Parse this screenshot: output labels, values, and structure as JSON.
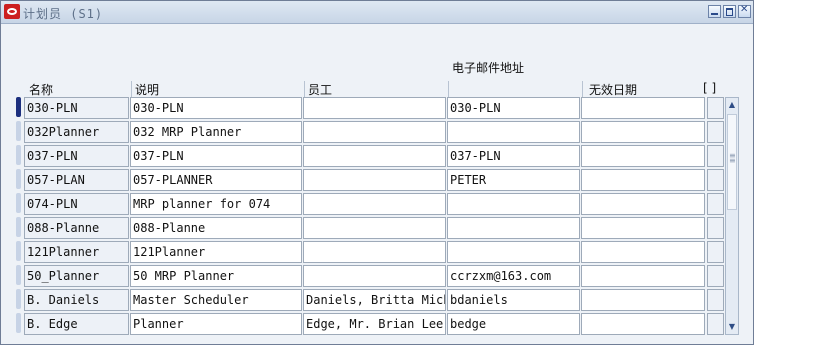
{
  "window": {
    "title": "计划员 (S1)"
  },
  "columns": {
    "name": "名称",
    "description": "说明",
    "employee": "员工",
    "email": "电子邮件地址",
    "inactive_date": "无效日期",
    "flex": "[ ]"
  },
  "rows": [
    {
      "name": "030-PLN",
      "description": "030-PLN",
      "employee": "",
      "email": "030-PLN",
      "inactive_date": ""
    },
    {
      "name": "032Planner",
      "description": "032 MRP Planner",
      "employee": "",
      "email": "",
      "inactive_date": ""
    },
    {
      "name": "037-PLN",
      "description": "037-PLN",
      "employee": "",
      "email": "037-PLN",
      "inactive_date": ""
    },
    {
      "name": "057-PLAN",
      "description": "057-PLANNER",
      "employee": "",
      "email": "PETER",
      "inactive_date": ""
    },
    {
      "name": "074-PLN",
      "description": "MRP planner for 074",
      "employee": "",
      "email": "",
      "inactive_date": ""
    },
    {
      "name": "088-Planne",
      "description": "088-Planne",
      "employee": "",
      "email": "",
      "inactive_date": ""
    },
    {
      "name": "121Planner",
      "description": "121Planner",
      "employee": "",
      "email": "",
      "inactive_date": ""
    },
    {
      "name": "50_Planner",
      "description": "50 MRP Planner",
      "employee": "",
      "email": "ccrzxm@163.com",
      "inactive_date": ""
    },
    {
      "name": "B. Daniels",
      "description": "Master Scheduler",
      "employee": "Daniels, Britta Mich",
      "email": "bdaniels",
      "inactive_date": ""
    },
    {
      "name": "B. Edge",
      "description": "Planner",
      "employee": "Edge, Mr. Brian Lee",
      "email": "bedge",
      "inactive_date": ""
    }
  ],
  "icons": {
    "app": "oracle-logo-icon",
    "minimize": "minimize-icon",
    "maximize": "maximize-icon",
    "close": "close-icon",
    "scroll_up": "scroll-up-icon",
    "scroll_down": "scroll-down-icon"
  },
  "colors": {
    "current_record_marker": "#1c2f7e",
    "titlebar": "#c7d5e6"
  }
}
